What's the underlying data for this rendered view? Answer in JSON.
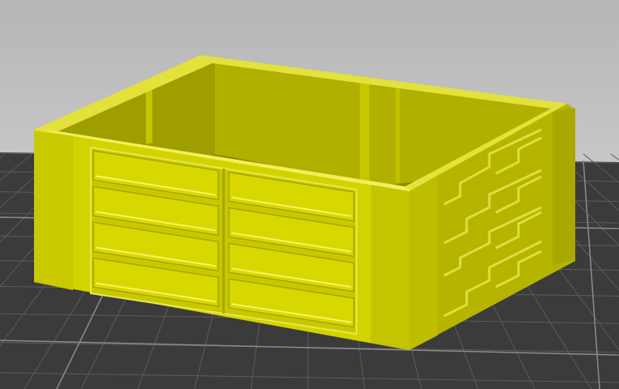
{
  "viewport": {
    "background_top": "#b9b9b9",
    "background_bottom": "#dadada",
    "bed_color": "#3a3a3a",
    "bed_grid_color": "#5e5e5e",
    "bed_grid_major_color": "#8a8a8a"
  },
  "model": {
    "color_front": "#d6d600",
    "color_side": "#b7b700",
    "color_top": "#e6e630",
    "color_inner": "#9a9a00",
    "color_highlight": "#ffff60",
    "color_shadow": "#7d7d00"
  }
}
